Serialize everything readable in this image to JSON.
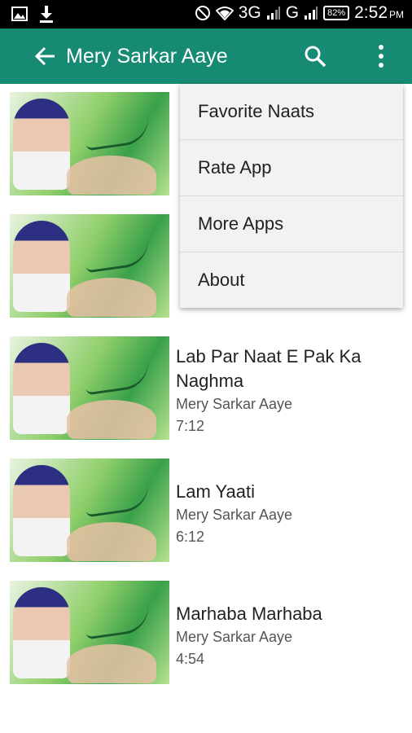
{
  "status_bar": {
    "network1": "3G",
    "network2": "G",
    "battery": "82%",
    "time": "2:52",
    "ampm": "PM"
  },
  "app_bar": {
    "title": "Mery Sarkar Aaye"
  },
  "list": [
    {
      "title": "Lab Par Naat E Pak Ka Naghma",
      "subtitle": "Mery Sarkar Aaye",
      "duration": "7:12"
    },
    {
      "title": "Lam Yaati",
      "subtitle": "Mery Sarkar Aaye",
      "duration": "6:12"
    },
    {
      "title": "Marhaba Marhaba",
      "subtitle": "Mery Sarkar Aaye",
      "duration": "4:54"
    }
  ],
  "overflow_menu": {
    "items": [
      "Favorite Naats",
      "Rate App",
      "More Apps",
      "About"
    ]
  }
}
